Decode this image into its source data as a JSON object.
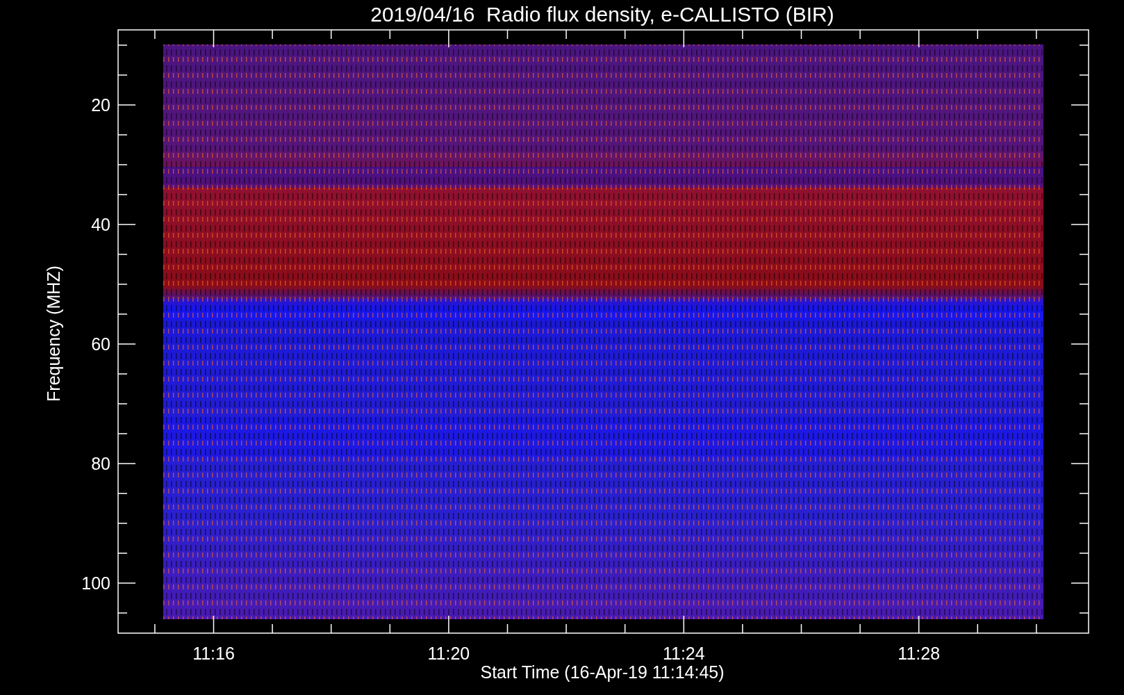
{
  "plot": {
    "title": "2019/04/16  Radio flux density, e-CALLISTO (BIR)",
    "ylabel": "Frequency (MHZ)",
    "yticks": [
      "20",
      "40",
      "60",
      "80",
      "100"
    ],
    "xticks": [
      "11:16",
      "11:20",
      "11:24",
      "11:28"
    ],
    "xlabel": "Start Time (16-Apr-19 11:14:45)",
    "spectrogram": {
      "kind": "picture"
    }
  }
}
